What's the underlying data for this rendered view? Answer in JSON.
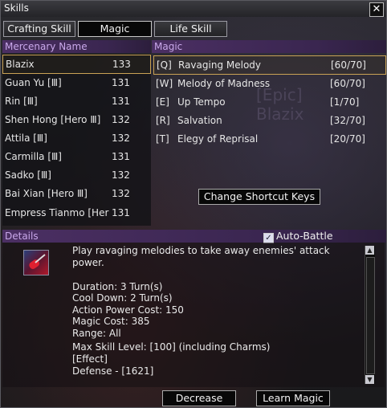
{
  "window": {
    "title": "Skills"
  },
  "tabs": [
    {
      "label": "Crafting Skill",
      "active": false
    },
    {
      "label": "Magic",
      "active": true
    },
    {
      "label": "Life Skill",
      "active": false
    }
  ],
  "mercenary": {
    "header": "Mercenary Name",
    "rows": [
      {
        "name": "Blazix",
        "level": "133",
        "selected": true
      },
      {
        "name": "Guan Yu [Ⅲ]",
        "level": "131"
      },
      {
        "name": "Rin [Ⅲ]",
        "level": "131"
      },
      {
        "name": "Shen Hong [Hero Ⅲ]",
        "level": "132"
      },
      {
        "name": "Attila [Ⅲ]",
        "level": "132"
      },
      {
        "name": "Carmilla [Ⅲ]",
        "level": "131"
      },
      {
        "name": "Sadko [Ⅲ]",
        "level": "132"
      },
      {
        "name": "Bai Xian [Hero Ⅲ]",
        "level": "132"
      },
      {
        "name": "Empress Tianmo [Her",
        "level": "131"
      }
    ]
  },
  "magic": {
    "header": "Magic",
    "rows": [
      {
        "key": "[Q]",
        "name": "Ravaging Melody",
        "level": "[60/70]",
        "selected": true
      },
      {
        "key": "[W]",
        "name": "Melody of Madness",
        "level": "[60/70]"
      },
      {
        "key": "[E]",
        "name": "Up Tempo",
        "level": "[1/70]"
      },
      {
        "key": "[R]",
        "name": "Salvation",
        "level": "[32/70]"
      },
      {
        "key": "[T]",
        "name": "Elegy of Reprisal",
        "level": "[20/70]"
      }
    ],
    "change_shortcut_label": "Change Shortcut Keys"
  },
  "background": {
    "line1": "[Epic]",
    "line2": "Blazix"
  },
  "details": {
    "header": "Details",
    "auto_battle_label": "Auto-Battle",
    "auto_battle_checked": true,
    "icon": "ravaging-melody-skill-icon",
    "lines": [
      "Play ravaging melodies to take away enemies' attack",
      "power.",
      "",
      "Duration: 3 Turn(s)",
      "Cool Down: 2 Turn(s)",
      "Action Power Cost: 150",
      "Magic Cost: 385",
      "Range: All",
      "Max Skill Level: [100] (including Charms)",
      "[Effect]",
      "Defense - [1621]"
    ]
  },
  "buttons": {
    "decrease": "Decrease",
    "learn_magic": "Learn Magic"
  }
}
